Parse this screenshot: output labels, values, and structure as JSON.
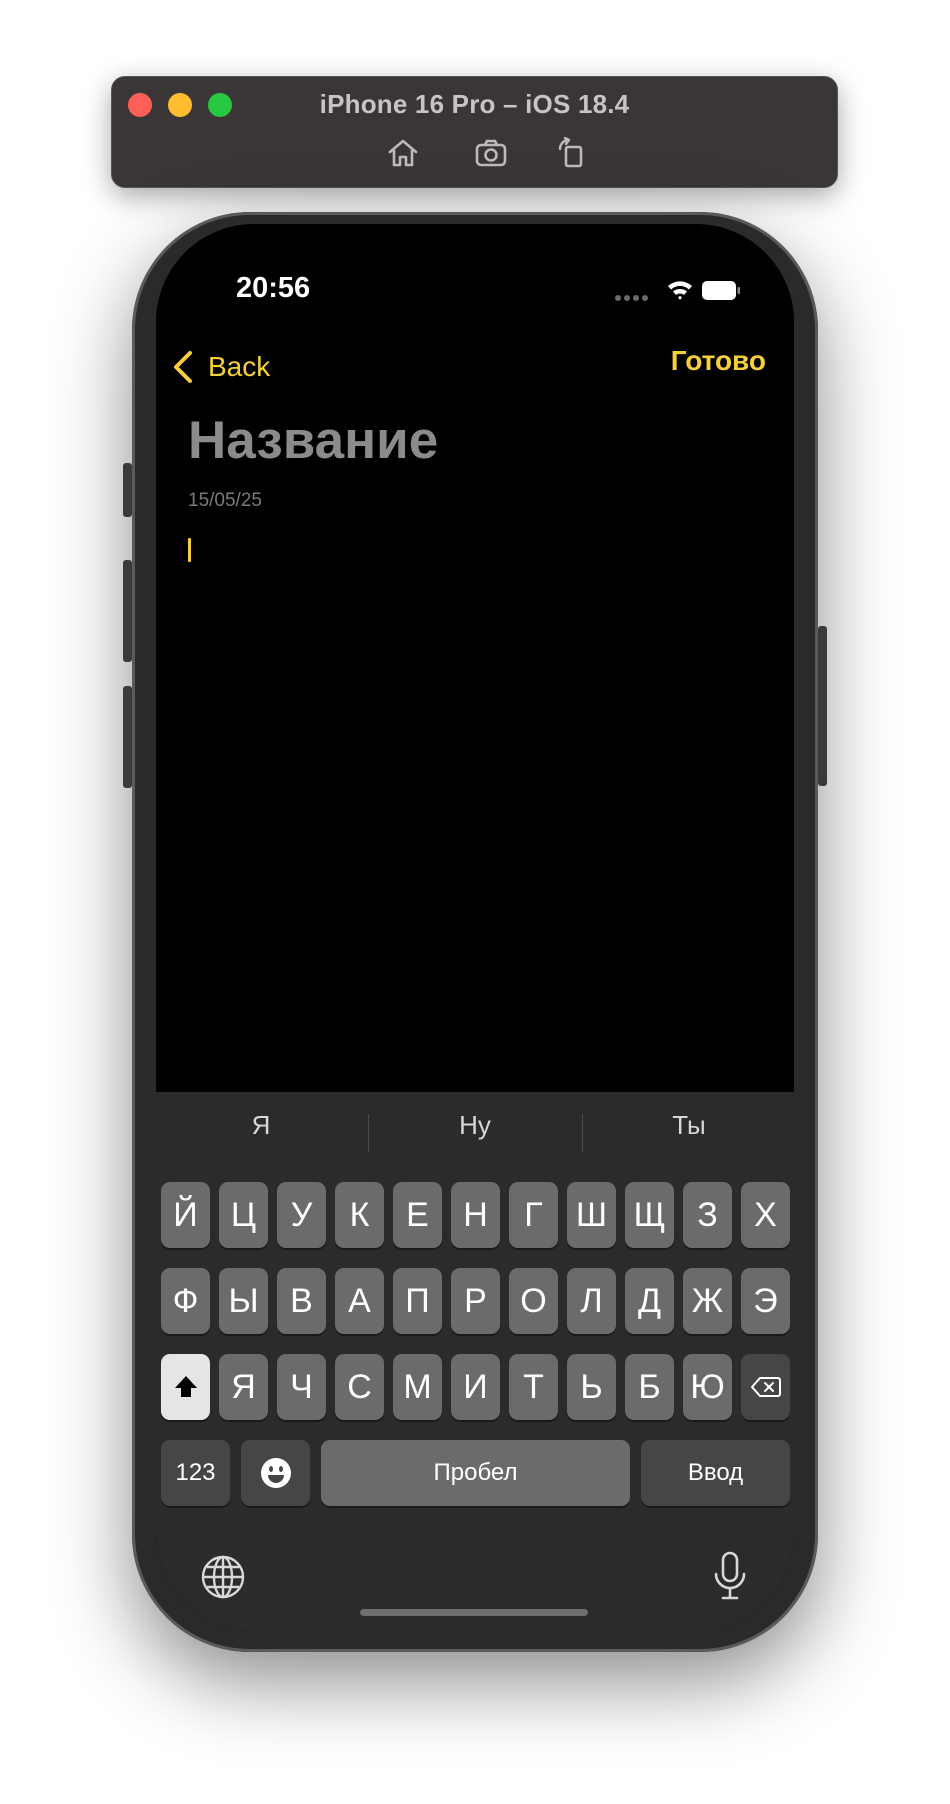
{
  "window": {
    "title": "iPhone 16 Pro – iOS 18.4",
    "toolbar_icons": [
      "home-icon",
      "screenshot-icon",
      "rotate-icon"
    ]
  },
  "status_bar": {
    "time": "20:56",
    "icons": [
      "cellular-dots-icon",
      "wifi-icon",
      "battery-icon"
    ]
  },
  "nav": {
    "back_label": "Back",
    "done_label": "Готово"
  },
  "note": {
    "title_placeholder": "Название",
    "date": "15/05/25"
  },
  "keyboard": {
    "suggestions": [
      "Я",
      "Ну",
      "Ты"
    ],
    "row1": [
      "Й",
      "Ц",
      "У",
      "К",
      "Е",
      "Н",
      "Г",
      "Ш",
      "Щ",
      "З",
      "Х"
    ],
    "row2": [
      "Ф",
      "Ы",
      "В",
      "А",
      "П",
      "Р",
      "О",
      "Л",
      "Д",
      "Ж",
      "Э"
    ],
    "row3": [
      "Я",
      "Ч",
      "С",
      "М",
      "И",
      "Т",
      "Ь",
      "Б",
      "Ю"
    ],
    "numbers_label": "123",
    "space_label": "Пробел",
    "return_label": "Ввод",
    "bottom_icons": [
      "globe-icon",
      "microphone-icon"
    ]
  },
  "colors": {
    "accent": "#f6cf3b",
    "key": "#6b6b6e",
    "key_dark": "#464649",
    "keyboard_bg": "#2b2b2d"
  }
}
